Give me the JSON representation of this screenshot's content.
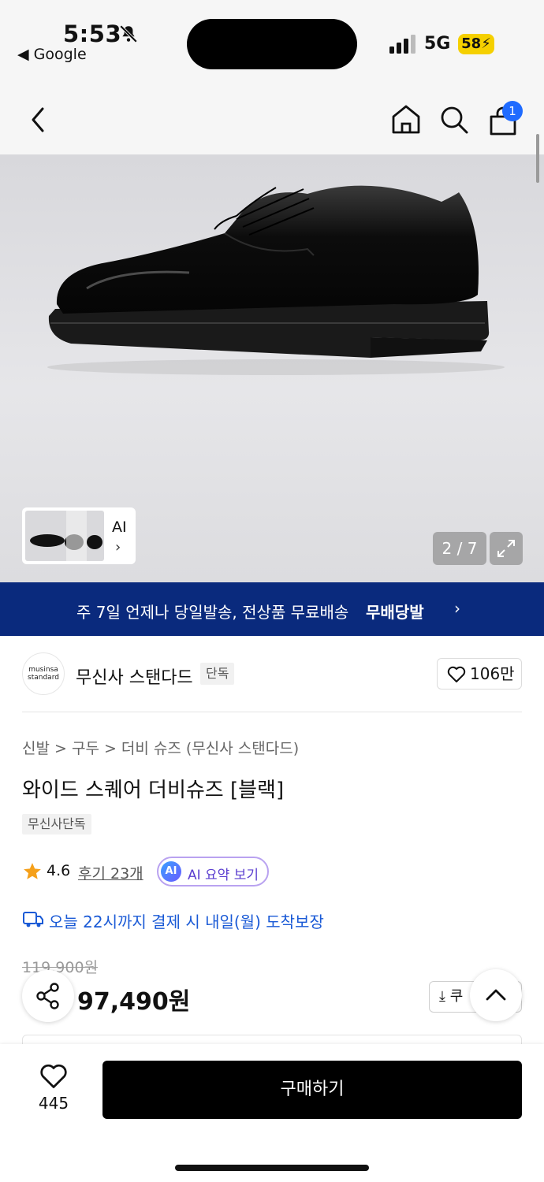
{
  "status_bar": {
    "time": "5:53",
    "back_app": "◀ Google",
    "network": "5G",
    "battery": "58"
  },
  "header": {
    "cart_count": "1"
  },
  "gallery": {
    "thumb_label": "AI",
    "thumb_chevron": "›",
    "counter": "2 / 7"
  },
  "banner": {
    "text": "주 7일 언제나 당일발송, 전상품 무료배송",
    "logo": "무배당발",
    "chevron": "›"
  },
  "brand": {
    "logo_text_1": "musinsa",
    "logo_text_2": "standard",
    "name": "무신사 스탠다드",
    "tag": "단독",
    "likes": "106만"
  },
  "product": {
    "breadcrumb": "신발 > 구두 > 더비 슈즈 (무신사 스탠다드)",
    "title": "와이드 스퀘어 더비슈즈 [블랙]",
    "exclusive_tag": "무신사단독",
    "rating": "4.6",
    "reviews": "후기 23개",
    "ai_badge": "AI",
    "ai_summary": "AI 요약 보기",
    "delivery": "오늘 22시까지 결제 시 내일(월) 도착보장",
    "original_price": "119,900원",
    "price": "97,490원",
    "coupon_label": "쿠"
  },
  "bottom_bar": {
    "wish_count": "445",
    "buy_label": "구매하기"
  },
  "colors": {
    "banner_bg": "#0a2a7d",
    "accent_blue": "#1a5ad6",
    "badge_blue": "#1f6bff",
    "battery_yellow": "#f5d000",
    "star_orange": "#f5a01a"
  },
  "icons": [
    "bell-slash-icon",
    "back-arrow-icon",
    "home-icon",
    "search-icon",
    "shopping-bag-icon",
    "expand-icon",
    "heart-icon",
    "star-icon",
    "delivery-truck-icon",
    "share-icon",
    "download-icon",
    "chevron-up-icon"
  ]
}
